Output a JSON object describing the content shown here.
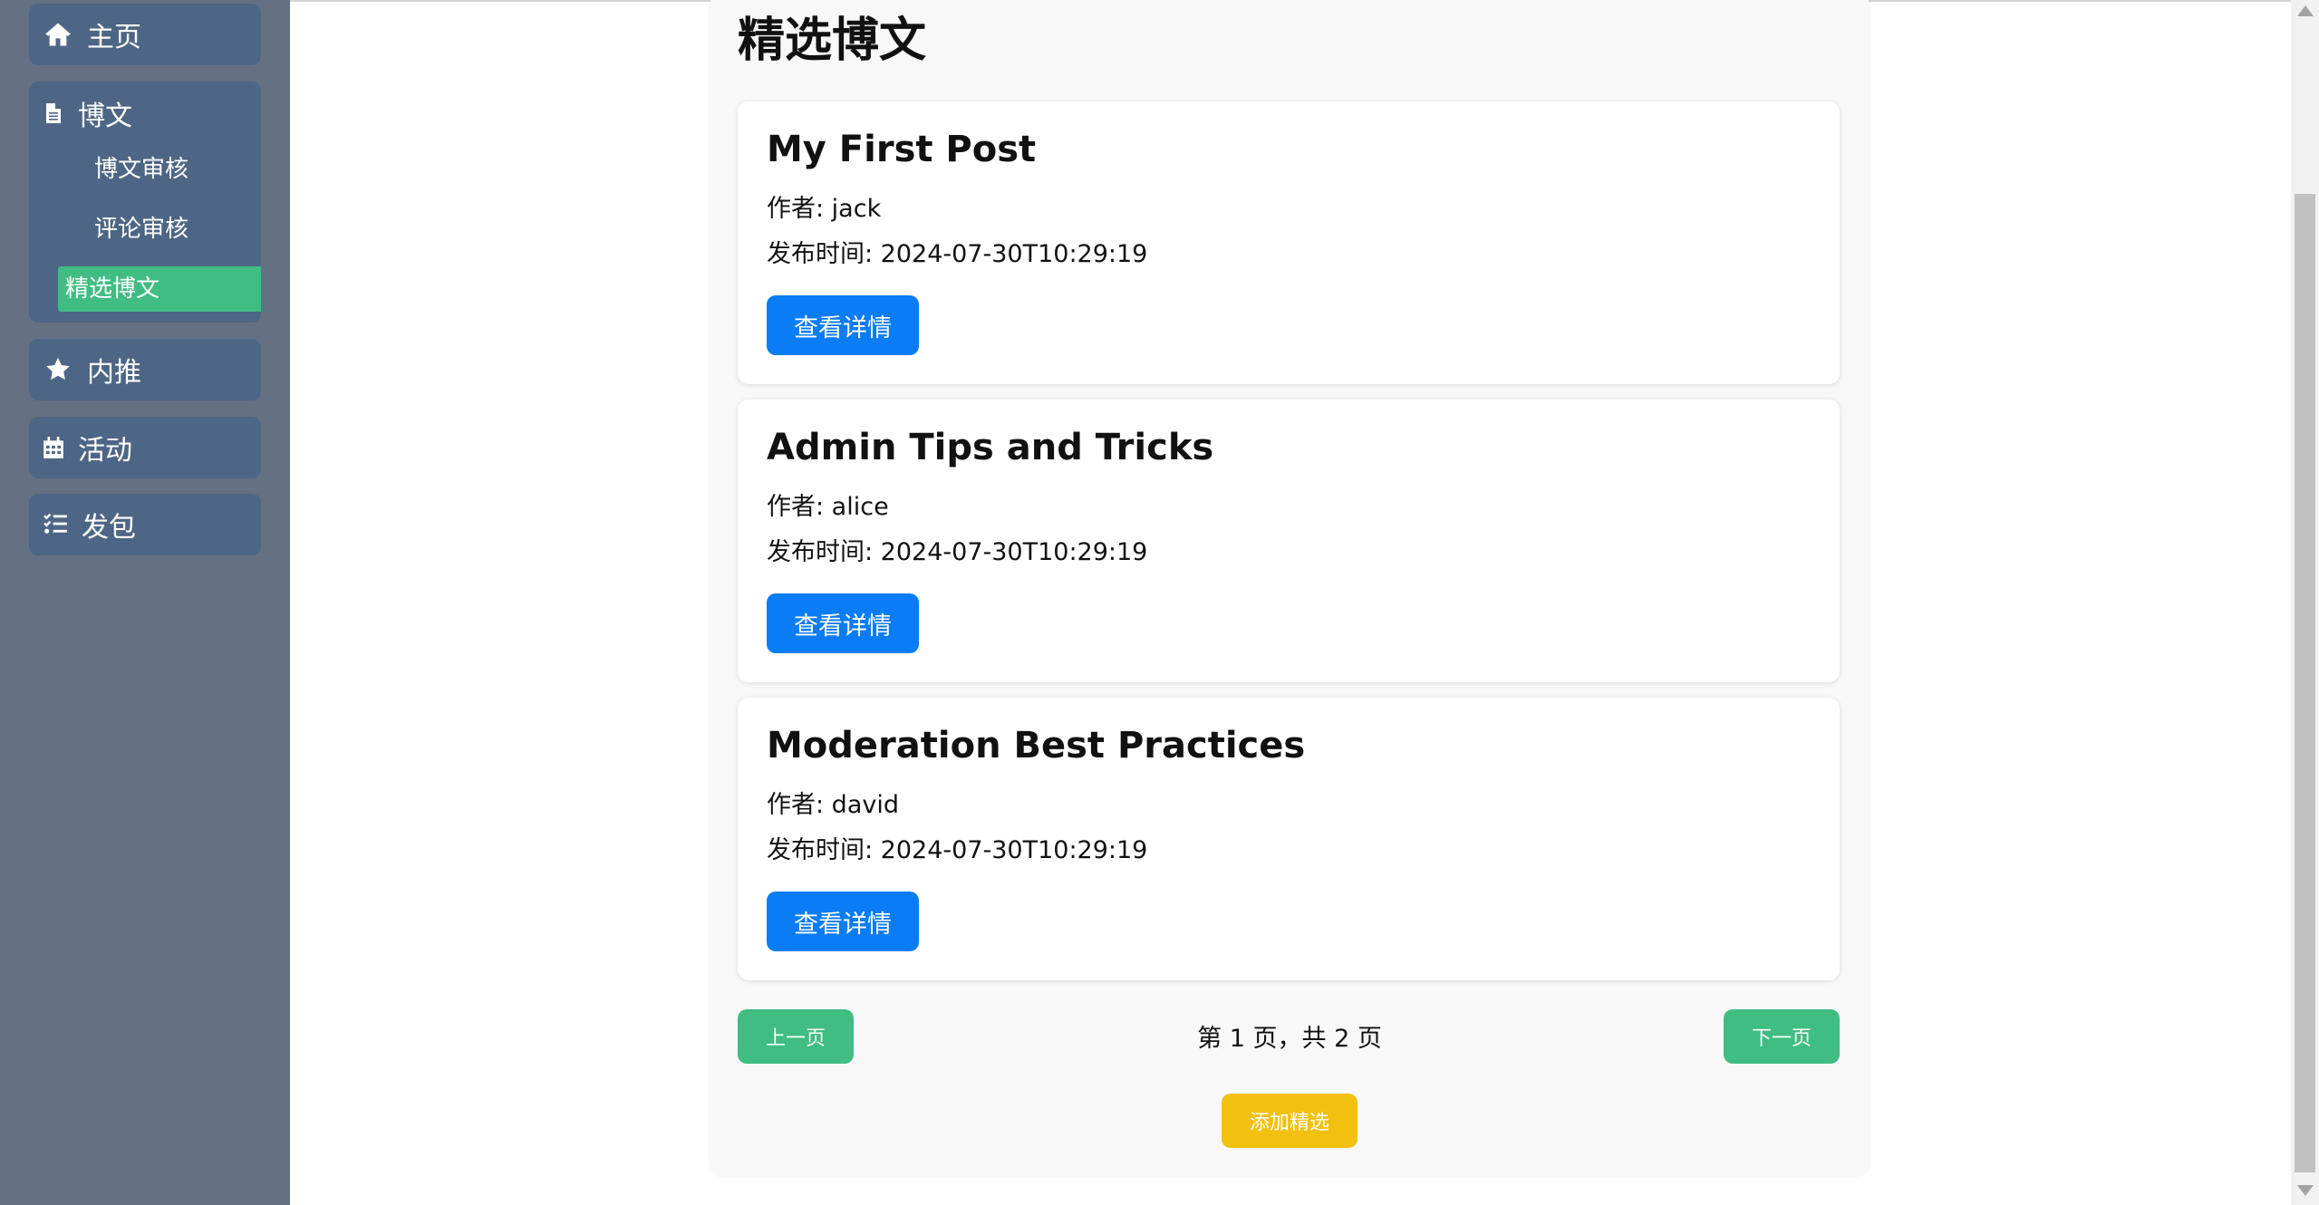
{
  "sidebar": {
    "home_label": "主页",
    "posts_label": "博文",
    "posts_sub": [
      "博文审核",
      "评论审核",
      "精选博文"
    ],
    "referral_label": "内推",
    "events_label": "活动",
    "packages_label": "发包",
    "active_color": "#3fbd82",
    "icons": [
      "home-icon",
      "file-icon",
      "star-icon",
      "calendar-icon",
      "list-check-icon"
    ]
  },
  "main": {
    "title": "精选博文",
    "posts": [
      {
        "title": "My First Post",
        "author": "作者: jack",
        "date": "发布时间: 2024-07-30T10:29:19",
        "button": "查看详情"
      },
      {
        "title": "Admin Tips and Tricks",
        "author": "作者: alice",
        "date": "发布时间: 2024-07-30T10:29:19",
        "button": "查看详情"
      },
      {
        "title": "Moderation Best Practices",
        "author": "作者: david",
        "date": "发布时间: 2024-07-30T10:29:19",
        "button": "查看详情"
      }
    ],
    "pagination": {
      "prev": "上一页",
      "info": "第 1 页，共 2 页",
      "next": "下一页"
    },
    "add_button": "添加精选",
    "colors": {
      "primary_button": "#0a7cf5",
      "pager_button": "#3fbd82",
      "add_button": "#f2c00f"
    }
  }
}
